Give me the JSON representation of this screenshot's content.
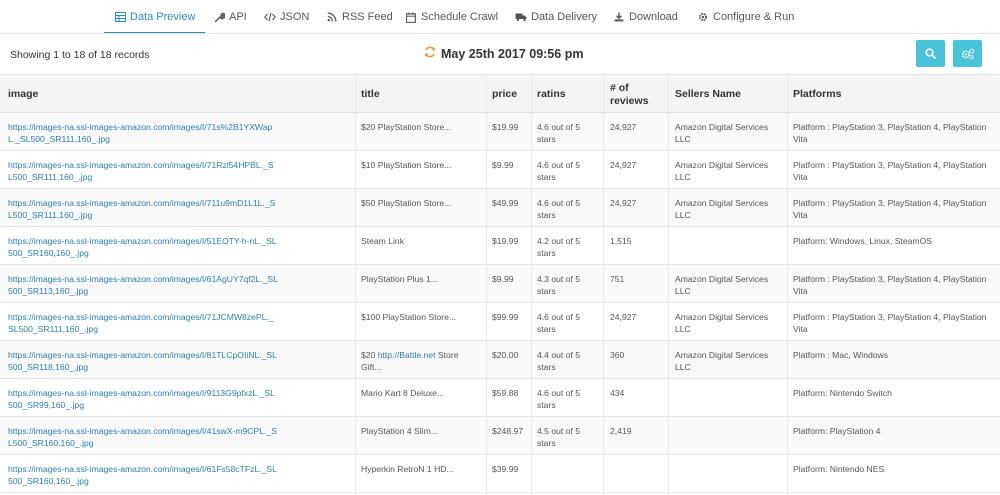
{
  "tabs": [
    {
      "label": "Data Preview",
      "icon": "table-icon",
      "active": true
    },
    {
      "label": "API",
      "icon": "wrench-icon"
    },
    {
      "label": "JSON",
      "icon": "code-icon"
    },
    {
      "label": "RSS Feed",
      "icon": "rss-icon"
    },
    {
      "label": "Schedule Crawl",
      "icon": "calendar-icon"
    },
    {
      "label": "Data Delivery",
      "icon": "truck-icon"
    },
    {
      "label": "Download",
      "icon": "download-icon"
    },
    {
      "label": "Configure & Run",
      "icon": "gear-icon"
    }
  ],
  "toolbar": {
    "records_text": "Showing 1 to 18 of 18 records",
    "timestamp": "May 25th 2017 09:56 pm",
    "accent_color": "#48c3d9",
    "refresh_color": "#f0963c"
  },
  "table": {
    "headers": [
      "image",
      "title",
      "price",
      "ratins",
      "# of reviews",
      "Sellers Name",
      "Platforms"
    ],
    "rows": [
      {
        "image": "https://images-na.ssl-images-amazon.com/images/I/71s%2B1YXWapL._SL500_SR111,160_.jpg",
        "title": "$20 PlayStation Store...",
        "price": "$19.99",
        "rating": "4.6 out of 5 stars",
        "reviews": "24,927",
        "seller": "Amazon Digital Services LLC",
        "platforms": "Platform : PlayStation 3, PlayStation 4, PlayStation Vita"
      },
      {
        "image": "https://images-na.ssl-images-amazon.com/images/I/71Rzl54HPBL._SL500_SR111,160_.jpg",
        "title": "$10 PlayStation Store...",
        "price": "$9.99",
        "rating": "4.6 out of 5 stars",
        "reviews": "24,927",
        "seller": "Amazon Digital Services LLC",
        "platforms": "Platform : PlayStation 3, PlayStation 4, PlayStation Vita"
      },
      {
        "image": "https://images-na.ssl-images-amazon.com/images/I/711u9mD1L1L._SL500_SR111,160_.jpg",
        "title": "$50 PlayStation Store...",
        "price": "$49.99",
        "rating": "4.6 out of 5 stars",
        "reviews": "24,927",
        "seller": "Amazon Digital Services LLC",
        "platforms": "Platform : PlayStation 3, PlayStation 4, PlayStation Vita"
      },
      {
        "image": "https://images-na.ssl-images-amazon.com/images/I/51EOTY-h-nL._SL500_SR160,160_.jpg",
        "title": "Steam Link",
        "price": "$19.99",
        "rating": "4.2 out of 5 stars",
        "reviews": "1,515",
        "seller": "",
        "platforms": "Platform: Windows, Linux, SteamOS"
      },
      {
        "image": "https://images-na.ssl-images-amazon.com/images/I/61AgUY7qf2L._SL500_SR113,160_.jpg",
        "title": "PlayStation Plus 1...",
        "price": "$9.99",
        "rating": "4.3 out of 5 stars",
        "reviews": "751",
        "seller": "Amazon Digital Services LLC",
        "platforms": "Platform : PlayStation 3, PlayStation 4, PlayStation Vita"
      },
      {
        "image": "https://images-na.ssl-images-amazon.com/images/I/71JCMW8zePL._SL500_SR111,160_.jpg",
        "title": "$100 PlayStation Store...",
        "price": "$99.99",
        "rating": "4.6 out of 5 stars",
        "reviews": "24,927",
        "seller": "Amazon Digital Services LLC",
        "platforms": "Platform : PlayStation 3, PlayStation 4, PlayStation Vita"
      },
      {
        "image": "https://images-na.ssl-images-amazon.com/images/I/81TLCpOIiNL._SL500_SR118,160_.jpg",
        "title_prefix": "$20 ",
        "title_link": "http://Battle.net",
        "title_suffix": " Store Gift...",
        "price": "$20.00",
        "rating": "4.4 out of 5 stars",
        "reviews": "360",
        "seller": "Amazon Digital Services LLC",
        "platforms": "Platform : Mac, Windows"
      },
      {
        "image": "https://images-na.ssl-images-amazon.com/images/I/9113G9pfxzL._SL500_SR99,160_.jpg",
        "title": "Mario Kart 8 Deluxe...",
        "price": "$59.88",
        "rating": "4.6 out of 5 stars",
        "reviews": "434",
        "seller": "",
        "platforms": "Platform: Nintendo Switch"
      },
      {
        "image": "https://images-na.ssl-images-amazon.com/images/I/41swX-m9CPL._SL500_SR160,160_.jpg",
        "title": "PlayStation 4 Slim...",
        "price": "$248.97",
        "rating": "4.5 out of 5 stars",
        "reviews": "2,419",
        "seller": "",
        "platforms": "Platform: PlayStation 4"
      },
      {
        "image": "https://images-na.ssl-images-amazon.com/images/I/61Fs58cTFzL._SL500_SR160,160_.jpg",
        "title": "Hyperkin RetroN 1 HD...",
        "price": "$39.99",
        "rating": "",
        "reviews": "",
        "seller": "",
        "platforms": "Platform: Nintendo NES"
      }
    ]
  }
}
